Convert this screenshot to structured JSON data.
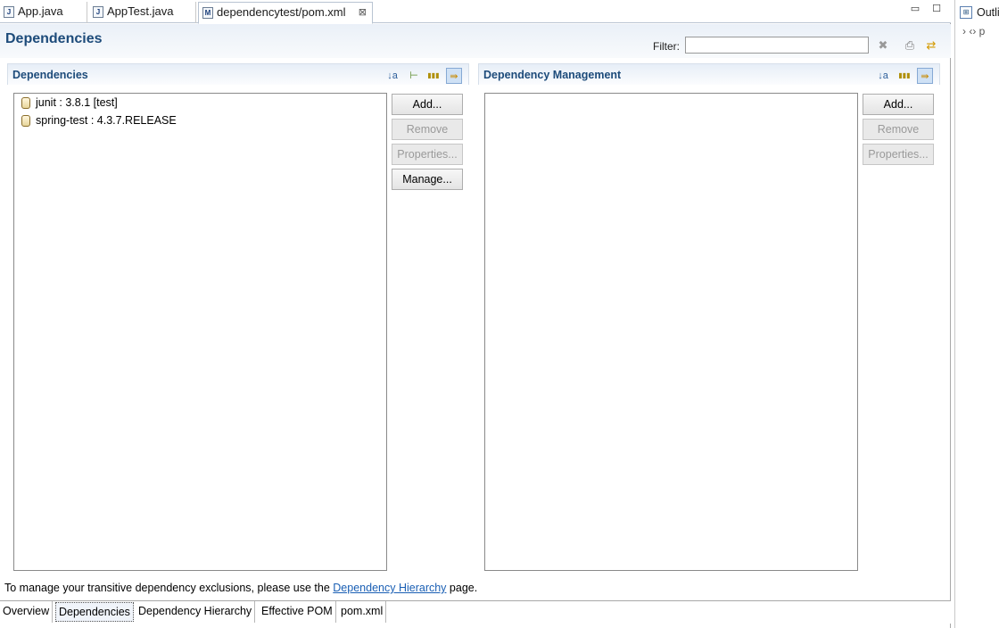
{
  "editor_tabs": [
    {
      "label": "App.java",
      "icon": "java-file-icon",
      "icon_glyph": "J"
    },
    {
      "label": "AppTest.java",
      "icon": "java-file-icon",
      "icon_glyph": "J"
    },
    {
      "label": "dependencytest/pom.xml",
      "icon": "maven-pom-icon",
      "icon_glyph": "M",
      "active": true
    }
  ],
  "tab_close_glyph": "⊠",
  "window_controls": {
    "minimize": "▭",
    "maximize": "☐"
  },
  "form_title": "Dependencies",
  "filter": {
    "label": "Filter:",
    "value": "",
    "clear_glyph": "✖"
  },
  "header_icons": {
    "pom": "⎙",
    "sync": "⇄"
  },
  "dependencies": {
    "title": "Dependencies",
    "toolbar": [
      {
        "name": "sort-alpha-icon",
        "glyph": "↓a"
      },
      {
        "name": "hierarchy-icon",
        "glyph": "⊢"
      },
      {
        "name": "columns-icon",
        "glyph": "▮▮▮"
      },
      {
        "name": "filter-toggle-icon",
        "glyph": "⇛",
        "pressed": true
      }
    ],
    "items": [
      {
        "label": "junit : 3.8.1 [test]"
      },
      {
        "label": "spring-test : 4.3.7.RELEASE"
      }
    ],
    "buttons": [
      {
        "label": "Add...",
        "enabled": true
      },
      {
        "label": "Remove",
        "enabled": false
      },
      {
        "label": "Properties...",
        "enabled": false
      },
      {
        "label": "Manage...",
        "enabled": true
      }
    ]
  },
  "dependency_management": {
    "title": "Dependency Management",
    "toolbar": [
      {
        "name": "sort-alpha-icon",
        "glyph": "↓a"
      },
      {
        "name": "columns-icon",
        "glyph": "▮▮▮"
      },
      {
        "name": "filter-toggle-icon",
        "glyph": "⇛",
        "pressed": true
      }
    ],
    "items": [],
    "buttons": [
      {
        "label": "Add...",
        "enabled": true
      },
      {
        "label": "Remove",
        "enabled": false
      },
      {
        "label": "Properties...",
        "enabled": false
      }
    ]
  },
  "hint": {
    "prefix": "To manage your transitive dependency exclusions, please use the ",
    "link": "Dependency Hierarchy",
    "suffix": " page."
  },
  "bottom_tabs": [
    {
      "label": "Overview"
    },
    {
      "label": "Dependencies",
      "active": true
    },
    {
      "label": "Dependency Hierarchy"
    },
    {
      "label": "Effective POM"
    },
    {
      "label": "pom.xml"
    }
  ],
  "outline": {
    "tab_label": "Outline",
    "tab_glyph": "⊞",
    "row_text": "› ‹›",
    "row_suffix": "p"
  },
  "colors": {
    "title_blue": "#1d4b7a",
    "link_blue": "#1a5fb4",
    "disabled_text": "#9a9a9a"
  }
}
